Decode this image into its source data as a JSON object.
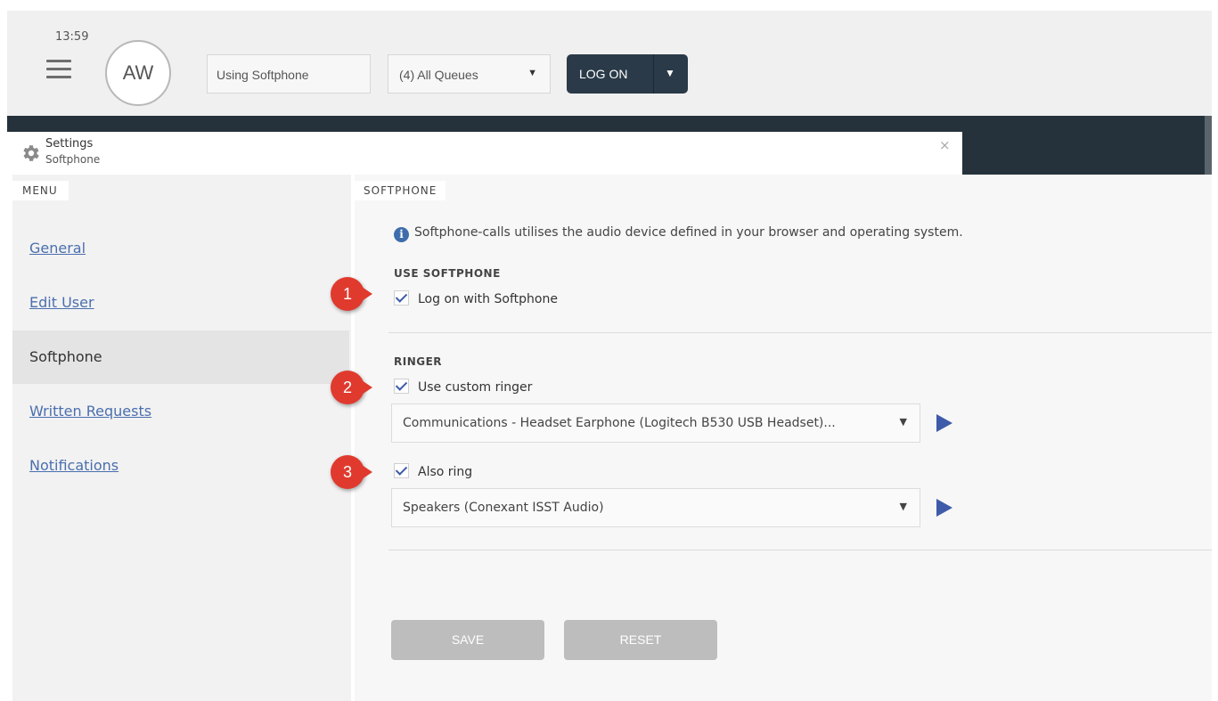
{
  "topbar": {
    "time": "13:59",
    "avatar_initials": "AW",
    "mode_value": "Using Softphone",
    "queue_value": "(4) All Queues",
    "logon_label": "LOG ON"
  },
  "dialog": {
    "title": "Settings",
    "subtitle": "Softphone",
    "close_glyph": "×"
  },
  "menu": {
    "heading": "MENU",
    "items": [
      {
        "label": "General",
        "active": false
      },
      {
        "label": "Edit User",
        "active": false
      },
      {
        "label": "Softphone",
        "active": true
      },
      {
        "label": "Written Requests",
        "active": false
      },
      {
        "label": "Notifications",
        "active": false
      }
    ]
  },
  "softphone": {
    "heading": "SOFTPHONE",
    "info_text": "Softphone-calls utilises the audio device defined in your browser and operating system.",
    "use_softphone_title": "USE SOFTPHONE",
    "log_on_with_softphone": {
      "label": "Log on with Softphone",
      "checked": true
    },
    "ringer_title": "RINGER",
    "use_custom_ringer": {
      "label": "Use custom ringer",
      "checked": true
    },
    "ringer_device": "Communications - Headset Earphone (Logitech B530 USB Headset)...",
    "also_ring": {
      "label": "Also ring",
      "checked": true
    },
    "also_ring_device": "Speakers (Conexant ISST Audio)",
    "save_label": "SAVE",
    "reset_label": "RESET"
  },
  "annotations": [
    "1",
    "2",
    "3"
  ],
  "colors": {
    "accent": "#3d5ba9",
    "link": "#4a6fae",
    "badge": "#e03a2e",
    "dark_band": "#26323b",
    "logon_button": "#2a3a48",
    "disabled_button": "#bdbdbd"
  }
}
